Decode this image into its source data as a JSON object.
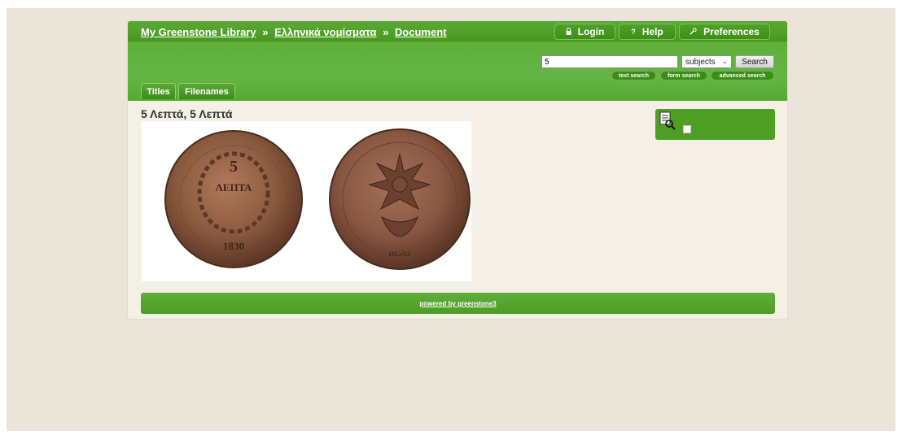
{
  "breadcrumb": {
    "home": "My Greenstone Library",
    "sep1": "»",
    "collection": "Ελληνικά νομίσματα",
    "sep2": "»",
    "current": "Document"
  },
  "top_nav": {
    "login": "Login",
    "help": "Help",
    "preferences": "Preferences",
    "login_icon": "lock-icon",
    "help_icon": "question-icon",
    "preferences_icon": "wrench-icon"
  },
  "search": {
    "query": "5",
    "field": "subjects",
    "button": "Search",
    "links": [
      "text search",
      "form search",
      "advanced search"
    ]
  },
  "tabs": [
    "Titles",
    "Filenames"
  ],
  "document": {
    "title": "5 Λεπτά, 5 Λεπτά"
  },
  "side_panel": {
    "icon": "search-document-icon"
  },
  "footer": {
    "powered_by": "powered by greenstone3"
  },
  "colors": {
    "page_background": "#ebe4d9",
    "content_background": "#f4f0e6",
    "header_green": "#4b9a22",
    "accent_green": "#5fb03a"
  }
}
